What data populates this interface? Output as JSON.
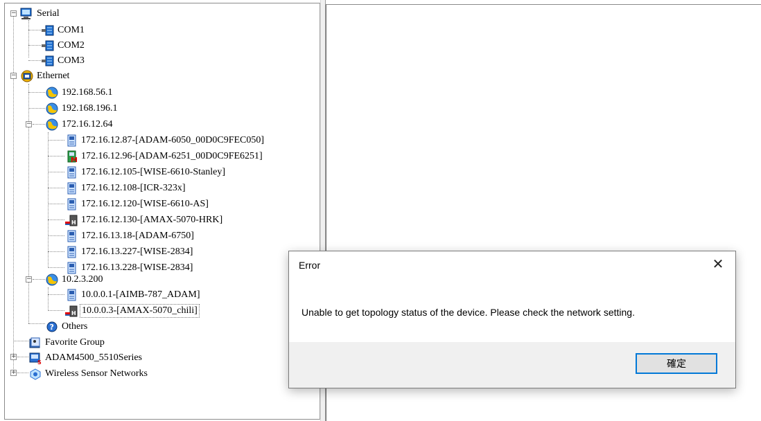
{
  "tree": {
    "root_items": [
      {
        "label": "Serial",
        "icon": "computer-icon"
      },
      {
        "label": "Ethernet",
        "icon": "network-globe-icon"
      },
      {
        "label": "Favorite Group",
        "icon": "favorite-group-icon"
      },
      {
        "label": "ADAM4500_5510Series",
        "icon": "adam-series-icon"
      },
      {
        "label": "Wireless Sensor Networks",
        "icon": "wireless-icon"
      }
    ],
    "serial_ports": [
      "COM1",
      "COM2",
      "COM3"
    ],
    "ethernet_hosts": [
      "192.168.56.1",
      "192.168.196.1",
      "172.16.12.64",
      "10.2.3.200",
      "Others"
    ],
    "devices_172": [
      {
        "label": "172.16.12.87-[ADAM-6050_00D0C9FEC050]",
        "icon": "device-module-icon"
      },
      {
        "label": "172.16.12.96-[ADAM-6251_00D0C9FE6251]",
        "icon": "device-m-icon"
      },
      {
        "label": "172.16.12.105-[WISE-6610-Stanley]",
        "icon": "device-module-icon"
      },
      {
        "label": "172.16.12.108-[ICR-323x]",
        "icon": "device-module-icon"
      },
      {
        "label": "172.16.12.120-[WISE-6610-AS]",
        "icon": "device-module-icon"
      },
      {
        "label": "172.16.12.130-[AMAX-5070-HRK]",
        "icon": "device-h-icon"
      },
      {
        "label": "172.16.13.18-[ADAM-6750]",
        "icon": "device-module-icon"
      },
      {
        "label": "172.16.13.227-[WISE-2834]",
        "icon": "device-module-icon"
      },
      {
        "label": "172.16.13.228-[WISE-2834]",
        "icon": "device-module-icon"
      }
    ],
    "devices_10": [
      {
        "label": "10.0.0.1-[AIMB-787_ADAM]",
        "icon": "device-module-icon"
      },
      {
        "label": "10.0.0.3-[AMAX-5070_chili]",
        "icon": "device-h-icon"
      }
    ]
  },
  "dialog": {
    "title": "Error",
    "close_glyph": "✕",
    "message": "Unable to get topology status of the device. Please check the network setting.",
    "ok_label": "確定"
  },
  "colors": {
    "accent": "#0078d7",
    "footer": "#f0f0f0"
  }
}
